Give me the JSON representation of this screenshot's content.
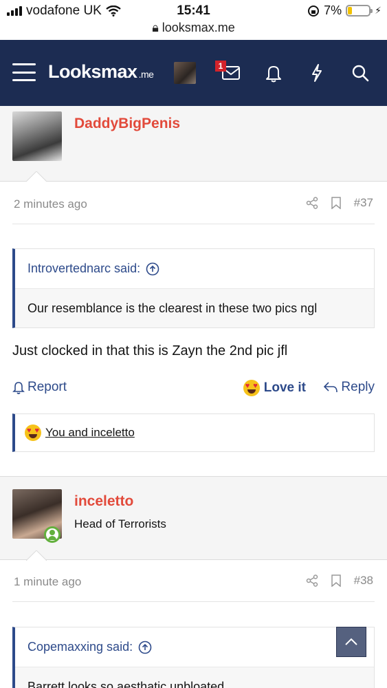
{
  "status_bar": {
    "carrier": "vodafone UK",
    "time": "15:41",
    "url": "looksmax.me",
    "battery": "7%"
  },
  "nav": {
    "logo": "Looksmax",
    "logo_tld": ".me",
    "message_badge": "1"
  },
  "posts": [
    {
      "username": "DaddyBigPenis",
      "time": "2 minutes ago",
      "number": "#37",
      "quote": {
        "author": "Introvertednarc said:",
        "text": "Our resemblance is the clearest in these two pics ngl"
      },
      "text": "Just clocked in that this is Zayn the 2nd pic jfl",
      "actions": {
        "report": "Report",
        "love": "Love it",
        "reply": "Reply"
      },
      "reactions": "You and inceletto"
    },
    {
      "username": "inceletto",
      "user_title": "Head of Terrorists",
      "time": "1 minute ago",
      "number": "#38",
      "quote": {
        "author": "Copemaxxing said:",
        "text": "Barrett looks so aesthatic unbloated"
      }
    }
  ],
  "colors": {
    "nav_bg": "#1c2c52",
    "accent": "#2d4a8a",
    "username": "#e24a3b"
  }
}
